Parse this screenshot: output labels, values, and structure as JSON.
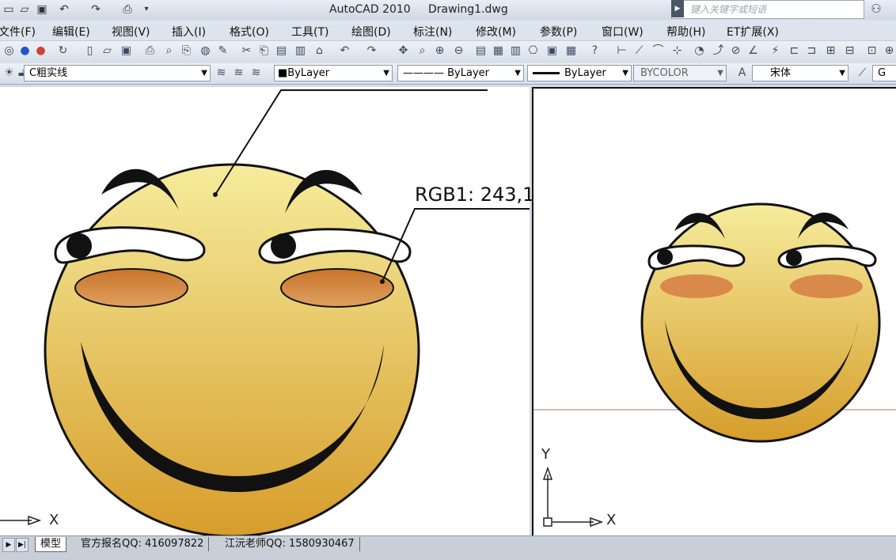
{
  "titlebar": {
    "app_title": "AutoCAD 2010     Drawing1.dwg",
    "search_placeholder": "键入关键字或短语",
    "quick_access_icons": [
      "open-icon",
      "save-icon",
      "undo-icon",
      "redo-icon",
      "print-icon"
    ]
  },
  "menu": {
    "items": [
      "文件(F)",
      "编辑(E)",
      "视图(V)",
      "插入(I)",
      "格式(O)",
      "工具(T)",
      "绘图(D)",
      "标注(N)",
      "修改(M)",
      "参数(P)",
      "窗口(W)",
      "帮助(H)",
      "ET扩展(X)"
    ]
  },
  "properties_toolbar": {
    "layer": "C粗实线",
    "color": "■ByLayer",
    "linetype": "———— ByLayer",
    "lineweight": "ByLayer",
    "plotstyle": "BYCOLOR",
    "font": "宋体",
    "trailing": "G"
  },
  "drawing": {
    "callout_text": "RGB1: 243,1",
    "axis_x": "X",
    "axis_y": "Y",
    "face_colors": {
      "top": "#f6ec9c",
      "bottom": "#d69d2b",
      "cheek": "#c8742a",
      "outline": "#111111"
    }
  },
  "tabs": {
    "model": "模型",
    "layout1": "官方报名QQ: 416097822",
    "layout2": "江沅老师QQ: 1580930467"
  }
}
